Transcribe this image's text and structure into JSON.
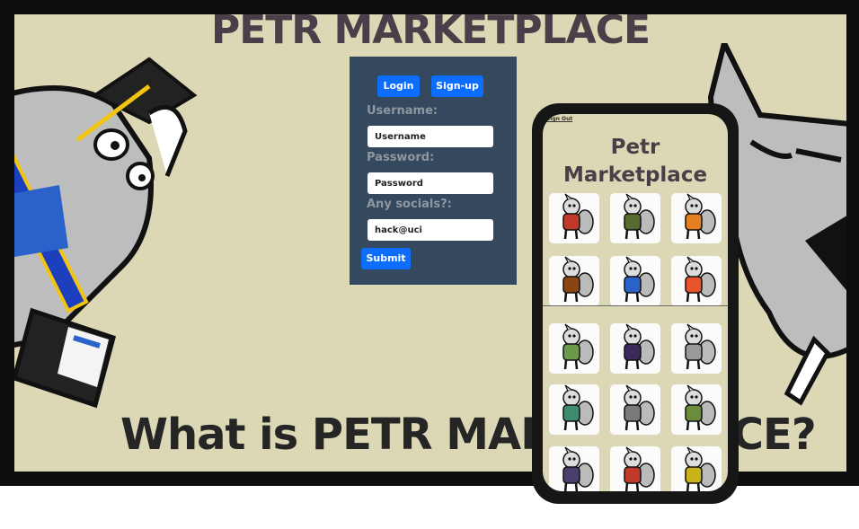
{
  "site": {
    "title": "PETR MARKETPLACE",
    "section_heading": "What is PETR MARKETPLACE?"
  },
  "login_panel": {
    "login_button": "Login",
    "signup_button": "Sign-up",
    "username_label": "Username:",
    "username_placeholder": "Username",
    "password_label": "Password:",
    "password_placeholder": "Password",
    "socials_label": "Any socials?:",
    "socials_value": "hack@uci",
    "submit_button": "Submit"
  },
  "phone": {
    "sign_out": "Sign Out",
    "title_line1": "Petr",
    "title_line2": "Marketplace",
    "stickers": [
      {
        "name": "petr-knight-sticker",
        "color": "#c0392b"
      },
      {
        "name": "petr-soldier-sticker",
        "color": "#556b2f"
      },
      {
        "name": "petr-party-hat-sticker",
        "color": "#e67e22"
      },
      {
        "name": "petr-reindeer-sticker",
        "color": "#8b4513"
      },
      {
        "name": "petr-blue-shirt-sticker",
        "color": "#2a62c9"
      },
      {
        "name": "petr-fire-sticker",
        "color": "#e8532b"
      },
      {
        "name": "petr-horse-sticker",
        "color": "#6a9a4a"
      },
      {
        "name": "petr-suit-sticker",
        "color": "#3b2a5a"
      },
      {
        "name": "petr-classic-sticker",
        "color": "#9a9a9a"
      },
      {
        "name": "petr-teal-sticker",
        "color": "#3d8c6e"
      },
      {
        "name": "petr-shopping-sticker",
        "color": "#7a7a7a"
      },
      {
        "name": "petr-green-sticker",
        "color": "#6b8c3a"
      },
      {
        "name": "petr-dark-sticker",
        "color": "#4b3d6e"
      },
      {
        "name": "petr-red-fox-sticker",
        "color": "#c0392b"
      },
      {
        "name": "petr-yellow-sticker",
        "color": "#c9b21a"
      }
    ]
  }
}
